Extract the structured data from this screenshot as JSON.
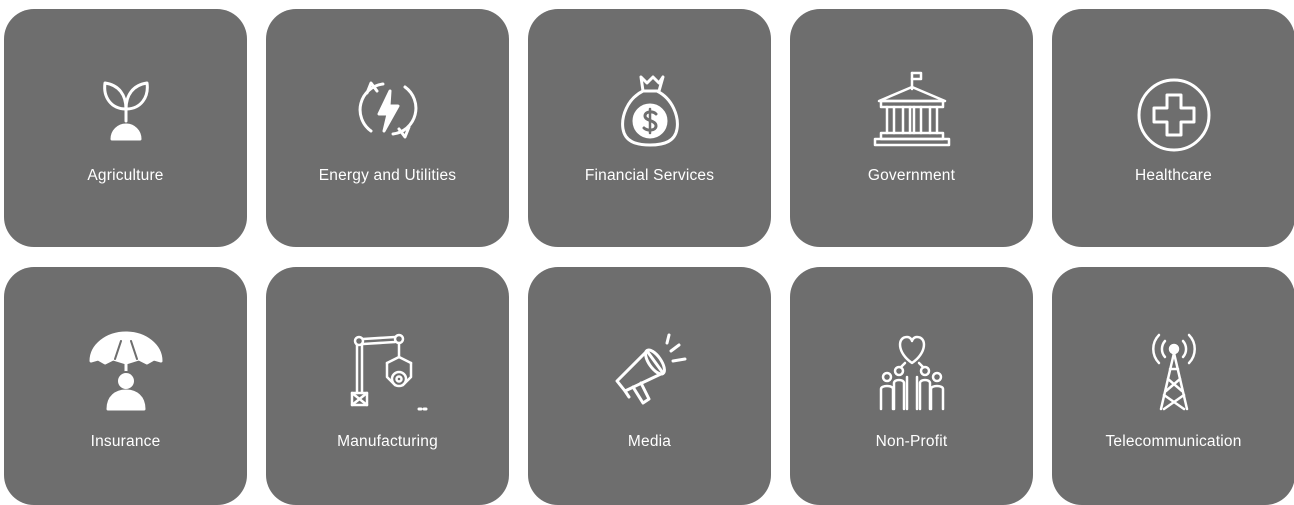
{
  "industries": [
    {
      "label": "Agriculture",
      "icon": "plant-sprout-icon"
    },
    {
      "label": "Energy and Utilities",
      "icon": "energy-lightning-icon"
    },
    {
      "label": "Financial Services",
      "icon": "money-bag-icon"
    },
    {
      "label": "Government",
      "icon": "government-building-icon"
    },
    {
      "label": "Healthcare",
      "icon": "medical-cross-icon"
    },
    {
      "label": "Insurance",
      "icon": "umbrella-person-icon"
    },
    {
      "label": "Manufacturing",
      "icon": "robotic-arm-icon"
    },
    {
      "label": "Media",
      "icon": "megaphone-icon"
    },
    {
      "label": "Non-Profit",
      "icon": "heart-hands-icon"
    },
    {
      "label": "Telecommunication",
      "icon": "signal-tower-icon"
    }
  ],
  "colors": {
    "tile_background": "#6e6e6e",
    "text": "#ffffff",
    "page_background": "#ffffff"
  }
}
